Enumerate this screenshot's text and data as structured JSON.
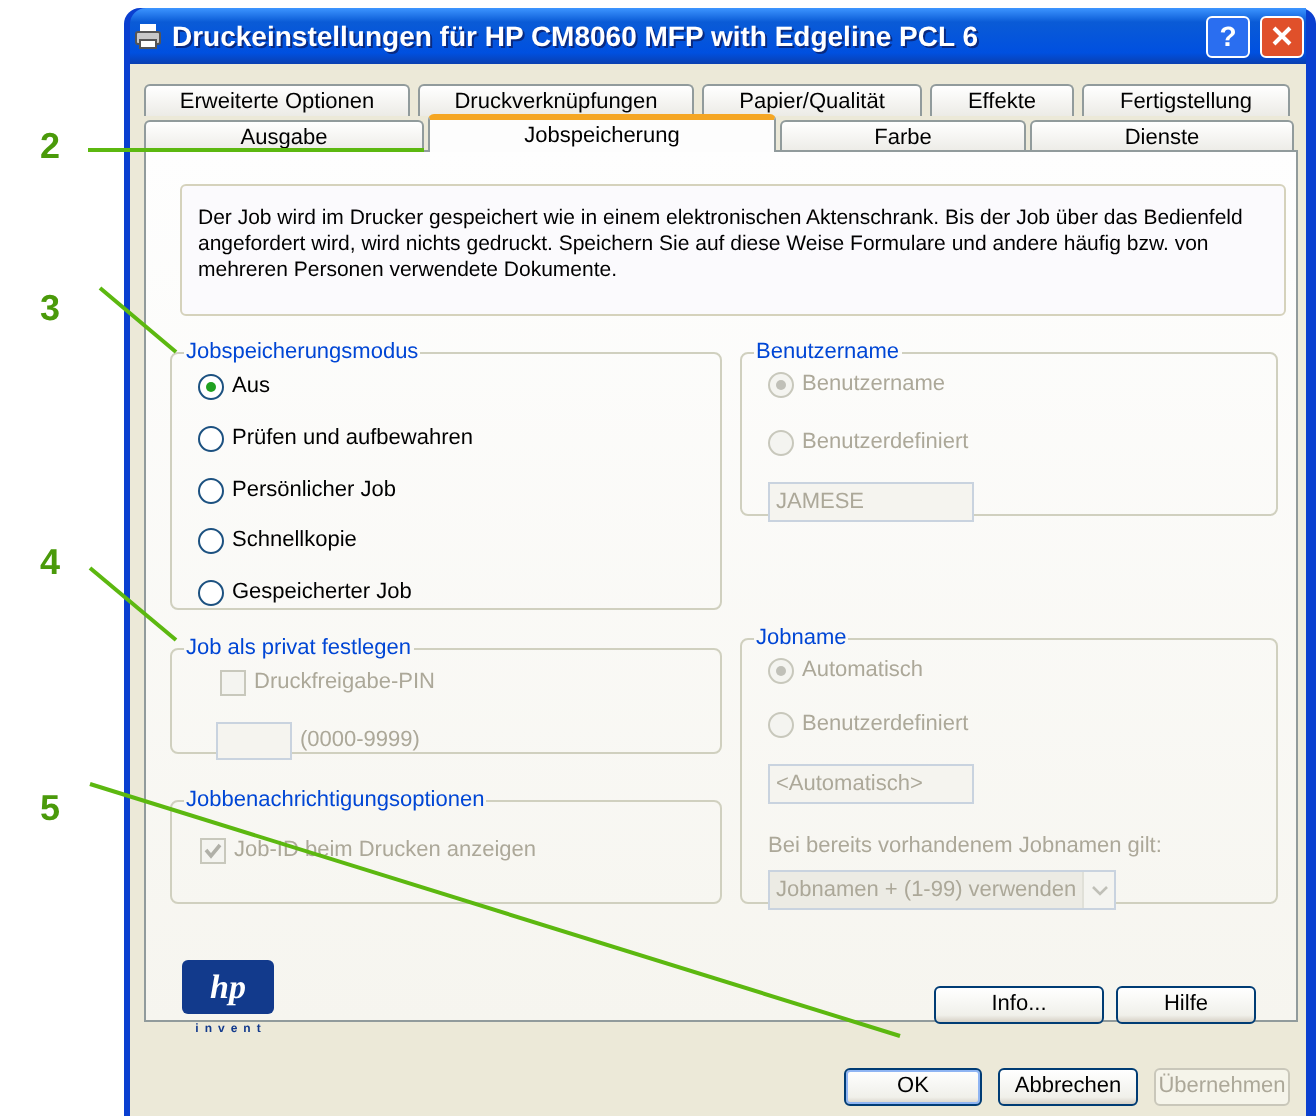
{
  "window": {
    "title": "Druckeinstellungen für HP CM8060 MFP with Edgeline PCL 6",
    "help_button": "?"
  },
  "tab_rows": [
    [
      {
        "label": "Erweiterte Optionen",
        "selected": false
      },
      {
        "label": "Druckverknüpfungen",
        "selected": false
      },
      {
        "label": "Papier/Qualität",
        "selected": false
      },
      {
        "label": "Effekte",
        "selected": false
      },
      {
        "label": "Fertigstellung",
        "selected": false
      }
    ],
    [
      {
        "label": "Ausgabe",
        "selected": false
      },
      {
        "label": "Jobspeicherung",
        "selected": true
      },
      {
        "label": "Farbe",
        "selected": false
      },
      {
        "label": "Dienste",
        "selected": false
      }
    ]
  ],
  "description": "Der Job wird im Drucker gespeichert wie in einem elektronischen Aktenschrank. Bis der Job über das Bedienfeld angefordert wird, wird nichts gedruckt. Speichern Sie auf diese Weise Formulare und andere häufig bzw. von mehreren Personen verwendete Dokumente.",
  "storage_mode": {
    "title": "Jobspeicherungsmodus",
    "disabled": false,
    "options": [
      {
        "label": "Aus",
        "selected": true
      },
      {
        "label": "Prüfen und aufbewahren",
        "selected": false
      },
      {
        "label": "Persönlicher Job",
        "selected": false
      },
      {
        "label": "Schnellkopie",
        "selected": false
      },
      {
        "label": "Gespeicherter Job",
        "selected": false
      }
    ]
  },
  "private": {
    "title": "Job als privat festlegen",
    "pin_checkbox": {
      "label": "Druckfreigabe-PIN",
      "checked": false,
      "disabled": true
    },
    "pin_range": "(0000-9999)"
  },
  "notification": {
    "title": "Jobbenachrichtigungsoptionen",
    "checkbox": {
      "label": "Job-ID beim Drucken anzeigen",
      "checked": true,
      "disabled": true
    }
  },
  "user_name": {
    "title": "Benutzername",
    "disabled": true,
    "options": [
      {
        "label": "Benutzername",
        "selected": true
      },
      {
        "label": "Benutzerdefiniert",
        "selected": false
      }
    ],
    "field": {
      "value": "JAMESE"
    }
  },
  "job_name": {
    "title": "Jobname",
    "disabled": true,
    "options": [
      {
        "label": "Automatisch",
        "selected": true
      },
      {
        "label": "Benutzerdefiniert",
        "selected": false
      }
    ],
    "field": {
      "value": "<Automatisch>"
    },
    "conflict_label": "Bei bereits vorhandenem Jobnamen gilt:",
    "conflict_select": {
      "value": "Jobnamen + (1-99) verwenden"
    }
  },
  "logo": {
    "mark": "hp",
    "tagline": "invent"
  },
  "panel_buttons": [
    {
      "label": "Info..."
    },
    {
      "label": "Hilfe"
    }
  ],
  "dialog_buttons": [
    {
      "label": "OK",
      "disabled": false,
      "default": true
    },
    {
      "label": "Abbrechen",
      "disabled": false,
      "default": false
    },
    {
      "label": "Übernehmen",
      "disabled": true,
      "default": false
    }
  ],
  "callouts": [
    {
      "label": "2"
    },
    {
      "label": "3"
    },
    {
      "label": "4"
    },
    {
      "label": "5"
    }
  ]
}
